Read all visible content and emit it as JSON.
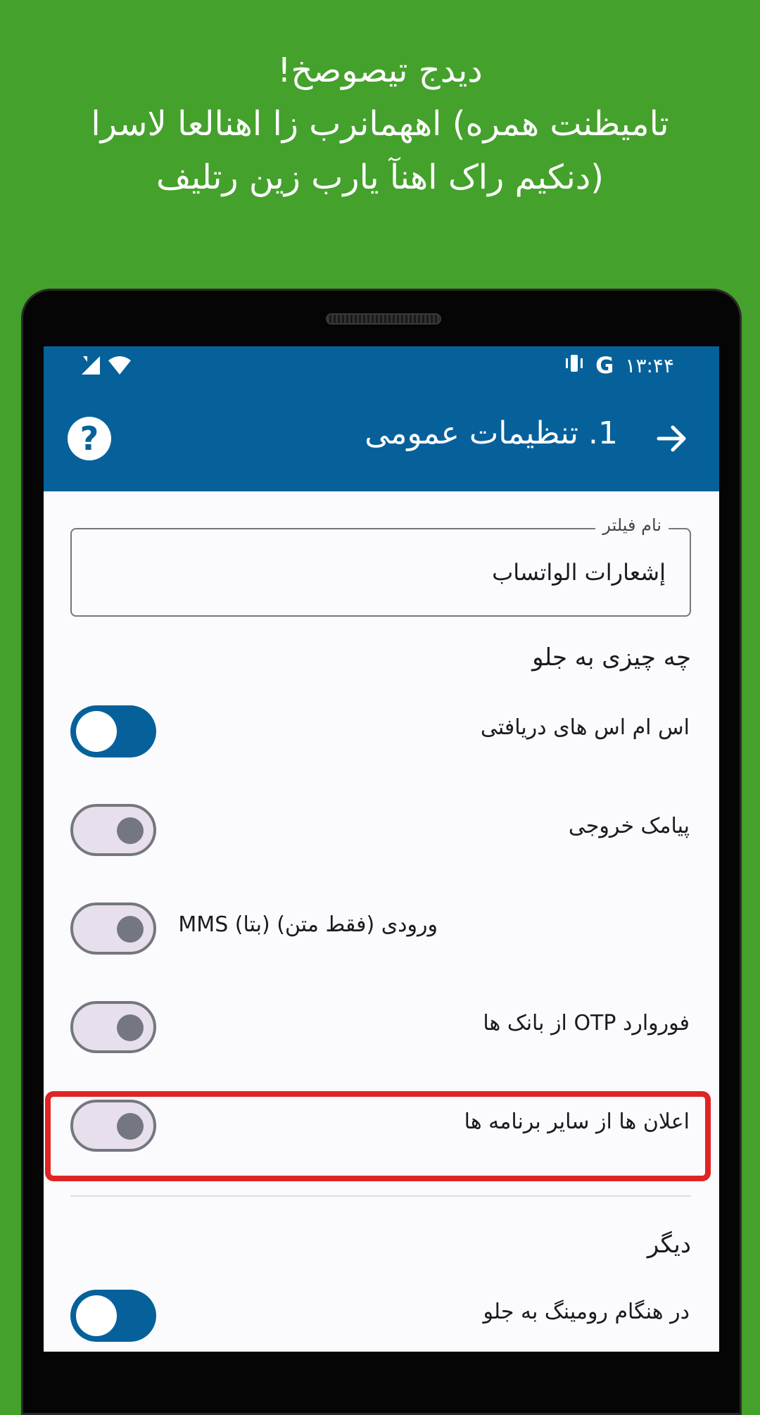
{
  "promo": {
    "line1": "دیدج تیصوصخ!",
    "line2": "تامیظنت هم​ره) اه​همانرب زا اه​نالعا لاسرا",
    "line3": "(دنک​یم راک اهنآ یارب زین رتلیف"
  },
  "status_bar": {
    "time": "۱۳:۴۴",
    "google_badge": "G",
    "icons": [
      "signal-icon",
      "wifi-icon",
      "vibrate-icon"
    ]
  },
  "app_bar": {
    "title": "1. تنظیمات عمومی",
    "help_glyph": "?",
    "color": "#06619b"
  },
  "filter_name": {
    "label": "نام فیلتر",
    "value": "إشعارات الواتساب"
  },
  "what_to_forward": {
    "heading": "چه چیزی به جلو",
    "items": [
      {
        "label": "اس ام اس های دریافتی",
        "on": true
      },
      {
        "label": "پیامک خروجی",
        "on": false
      },
      {
        "label": "ورودی (فقط متن) (بتا) MMS",
        "on": false
      },
      {
        "label": "فوروارد OTP از بانک ها",
        "on": false
      },
      {
        "label": "اعلان ها از سایر برنامه ها",
        "on": false,
        "highlighted": true
      }
    ]
  },
  "other": {
    "heading": "دیگر",
    "items": [
      {
        "label": "در هنگام رومینگ به جلو",
        "on": true
      }
    ]
  },
  "colors": {
    "background": "#44a12b",
    "accent": "#06619b",
    "highlight": "#e02424"
  }
}
